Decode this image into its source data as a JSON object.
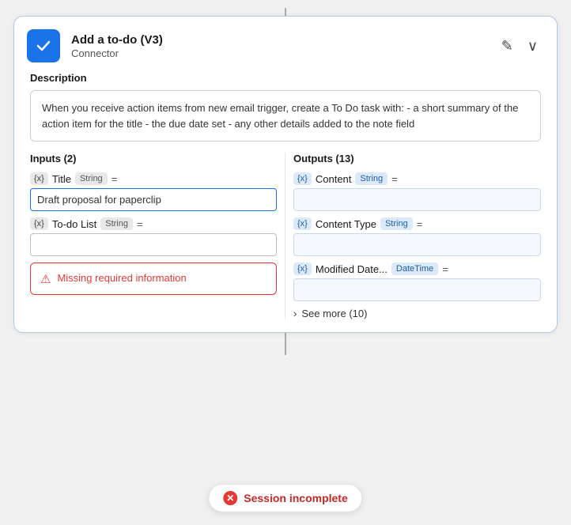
{
  "header": {
    "title": "Add a to-do (V3)",
    "subtitle": "Connector",
    "edit_label": "✎",
    "chevron_label": "∨"
  },
  "description": {
    "label": "Description",
    "text": "When you receive action items from new email trigger, create a To Do task with: - a short summary of the action item for the title - the due date set - any other details added to the note field"
  },
  "inputs": {
    "header": "Inputs (2)",
    "fields": [
      {
        "var_badge": "{x}",
        "name": "Title",
        "type": "String",
        "eq": "=",
        "value": "Draft proposal for paperclip",
        "filled": true
      },
      {
        "var_badge": "{x}",
        "name": "To-do List",
        "type": "String",
        "eq": "=",
        "value": "",
        "filled": false
      }
    ],
    "error": {
      "icon": "⚠",
      "text": "Missing required information"
    }
  },
  "outputs": {
    "header": "Outputs (13)",
    "fields": [
      {
        "var_badge": "{x}",
        "name": "Content",
        "type": "String",
        "eq": "=",
        "value": ""
      },
      {
        "var_badge": "{x}",
        "name": "Content Type",
        "type": "String",
        "eq": "=",
        "value": ""
      },
      {
        "var_badge": "{x}",
        "name": "Modified Date...",
        "type": "DateTime",
        "eq": "=",
        "value": ""
      }
    ],
    "see_more": {
      "count": "(10)",
      "text": "See more"
    }
  },
  "session": {
    "icon": "✕",
    "text": "Session incomplete"
  }
}
